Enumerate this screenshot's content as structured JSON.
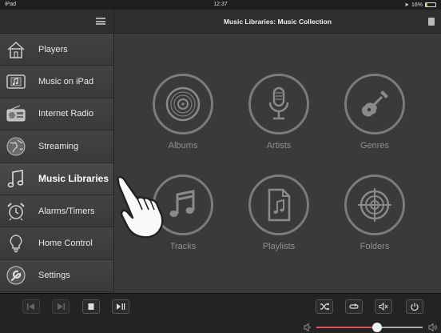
{
  "status": {
    "carrier": "iPad",
    "time": "12:37",
    "battery": "16%"
  },
  "header": {
    "title": "Music Libraries: Music Collection"
  },
  "sidebar": {
    "items": [
      {
        "label": "Players",
        "icon": "house-icon"
      },
      {
        "label": "Music on iPad",
        "icon": "music-on-ipad-icon"
      },
      {
        "label": "Internet Radio",
        "icon": "radio-icon"
      },
      {
        "label": "Streaming",
        "icon": "globe-icon"
      },
      {
        "label": "Music Libraries",
        "icon": "music-note-icon",
        "active": true
      },
      {
        "label": "Alarms/Timers",
        "icon": "alarm-clock-icon"
      },
      {
        "label": "Home Control",
        "icon": "lightbulb-icon"
      },
      {
        "label": "Settings",
        "icon": "settings-icon"
      }
    ]
  },
  "library": {
    "tiles": [
      {
        "label": "Albums",
        "icon": "vinyl-disc-icon"
      },
      {
        "label": "Artists",
        "icon": "microphone-icon"
      },
      {
        "label": "Genres",
        "icon": "guitar-icon"
      },
      {
        "label": "Tracks",
        "icon": "music-note-icon"
      },
      {
        "label": "Playlists",
        "icon": "playlist-file-icon"
      },
      {
        "label": "Folders",
        "icon": "target-icon"
      }
    ]
  },
  "volume": {
    "level": 0.57,
    "accent": "#d9534f"
  },
  "colors": {
    "background": "#3a3a3a",
    "sidebar": "#3b3b3b",
    "tile_stroke": "#7b7b7b",
    "label": "#8f8f8f"
  }
}
